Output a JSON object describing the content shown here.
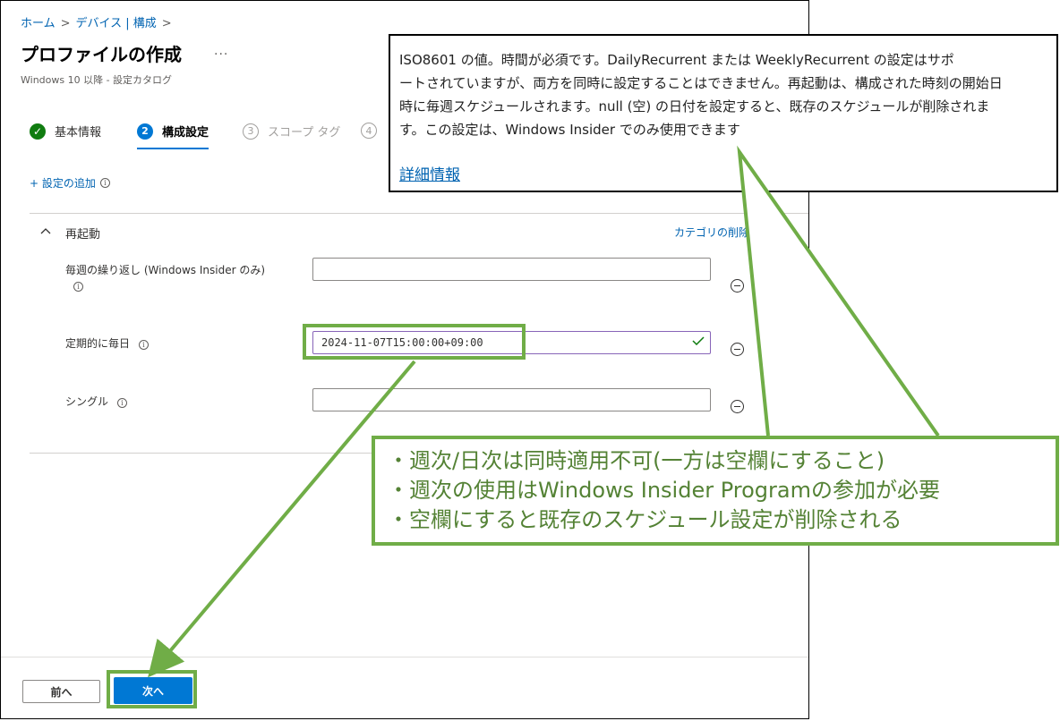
{
  "breadcrumb": {
    "home": "ホーム",
    "separator": ">",
    "devices": "デバイス | 構成",
    "trailing": ">"
  },
  "header": {
    "title": "プロファイルの作成",
    "more": "...",
    "subtitle": "Windows 10 以降 - 設定カタログ"
  },
  "steps": [
    {
      "number": "✓",
      "label": "基本情報",
      "state": "completed"
    },
    {
      "number": "2",
      "label": "構成設定",
      "state": "active"
    },
    {
      "number": "3",
      "label": "スコープ タグ",
      "state": "pending"
    },
    {
      "number": "4",
      "label": "",
      "state": "pending"
    }
  ],
  "add_setting": {
    "label": "+ 設定の追加",
    "info_icon": "i"
  },
  "section": {
    "chevron": "^",
    "title": "再起動",
    "category_delete": "カテゴリの削除"
  },
  "fields": {
    "weekly": {
      "label": "毎週の繰り返し (Windows Insider のみ)",
      "info_icon": "i",
      "value": ""
    },
    "daily": {
      "label": "定期的に毎日",
      "info_icon": "i",
      "value": "2024-11-07T15:00:00+09:00",
      "status": "valid"
    },
    "single": {
      "label": "シングル",
      "info_icon": "i",
      "value": ""
    }
  },
  "footer": {
    "prev_label": "前へ",
    "next_label": "次へ"
  },
  "tooltip": {
    "lines": [
      "ISO8601 の値。時間が必須です。DailyRecurrent または WeeklyRecurrent の設定はサポ",
      "ートされていますが、両方を同時に設定することはできません。再起動は、構成された時刻の開始日",
      "時に毎週スケジュールされます。null (空) の日付を設定すると、既存のスケジュールが削除されま",
      "す。この設定は、Windows Insider でのみ使用できます"
    ],
    "link": "詳細情報"
  },
  "callout": {
    "lines": [
      "・週次/日次は同時適用不可(一方は空欄にすること)",
      "・週次の使用はWindows Insider Programの参加が必要",
      "・空欄にすると既存のスケジュール設定が削除される"
    ]
  },
  "colors": {
    "accent": "#0078d4",
    "annotation": "#70ad47",
    "annotation_text": "#548235",
    "valid": "#107c10"
  }
}
